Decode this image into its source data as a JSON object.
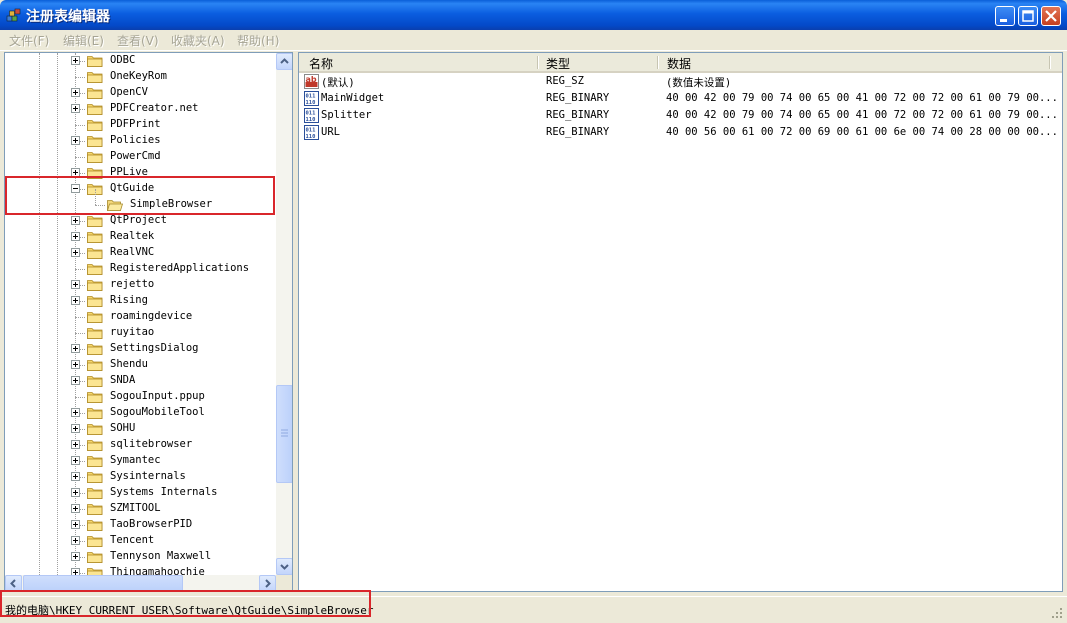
{
  "window": {
    "title": "注册表编辑器"
  },
  "menu": [
    {
      "label": "文件(F)"
    },
    {
      "label": "编辑(E)"
    },
    {
      "label": "查看(V)"
    },
    {
      "label": "收藏夹(A)"
    },
    {
      "label": "帮助(H)"
    }
  ],
  "tree": {
    "items": [
      {
        "label": "ODBC",
        "expander": "plus"
      },
      {
        "label": "OneKeyRom",
        "expander": "none"
      },
      {
        "label": "OpenCV",
        "expander": "plus"
      },
      {
        "label": "PDFCreator.net",
        "expander": "plus"
      },
      {
        "label": "PDFPrint",
        "expander": "none"
      },
      {
        "label": "Policies",
        "expander": "plus"
      },
      {
        "label": "PowerCmd",
        "expander": "none"
      },
      {
        "label": "PPLive",
        "expander": "plus"
      },
      {
        "label": "QtGuide",
        "expander": "minus"
      },
      {
        "label": "SimpleBrowser",
        "expander": "none",
        "child": true,
        "selected": true
      },
      {
        "label": "QtProject",
        "expander": "plus"
      },
      {
        "label": "Realtek",
        "expander": "plus"
      },
      {
        "label": "RealVNC",
        "expander": "plus"
      },
      {
        "label": "RegisteredApplications",
        "expander": "none"
      },
      {
        "label": "rejetto",
        "expander": "plus"
      },
      {
        "label": "Rising",
        "expander": "plus"
      },
      {
        "label": "roamingdevice",
        "expander": "none"
      },
      {
        "label": "ruyitao",
        "expander": "none"
      },
      {
        "label": "SettingsDialog",
        "expander": "plus"
      },
      {
        "label": "Shendu",
        "expander": "plus"
      },
      {
        "label": "SNDA",
        "expander": "plus"
      },
      {
        "label": "SogouInput.ppup",
        "expander": "none"
      },
      {
        "label": "SogouMobileTool",
        "expander": "plus"
      },
      {
        "label": "SOHU",
        "expander": "plus"
      },
      {
        "label": "sqlitebrowser",
        "expander": "plus"
      },
      {
        "label": "Symantec",
        "expander": "plus"
      },
      {
        "label": "Sysinternals",
        "expander": "plus"
      },
      {
        "label": "Systems Internals",
        "expander": "plus"
      },
      {
        "label": "SZMITOOL",
        "expander": "plus"
      },
      {
        "label": "TaoBrowserPID",
        "expander": "plus"
      },
      {
        "label": "Tencent",
        "expander": "plus"
      },
      {
        "label": "Tennyson Maxwell",
        "expander": "plus"
      },
      {
        "label": "Thingamahoochie",
        "expander": "plus"
      }
    ]
  },
  "list": {
    "columns": [
      {
        "label": "名称"
      },
      {
        "label": "类型"
      },
      {
        "label": "数据"
      }
    ],
    "rows": [
      {
        "icon": "string-value-icon",
        "name": "(默认)",
        "type": "REG_SZ",
        "data": "(数值未设置)"
      },
      {
        "icon": "binary-value-icon",
        "name": "MainWidget",
        "type": "REG_BINARY",
        "data": "40 00 42 00 79 00 74 00 65 00 41 00 72 00 72 00 61 00 79 00..."
      },
      {
        "icon": "binary-value-icon",
        "name": "Splitter",
        "type": "REG_BINARY",
        "data": "40 00 42 00 79 00 74 00 65 00 41 00 72 00 72 00 61 00 79 00..."
      },
      {
        "icon": "binary-value-icon",
        "name": "URL",
        "type": "REG_BINARY",
        "data": "40 00 56 00 61 00 72 00 69 00 61 00 6e 00 74 00 28 00 00 00..."
      }
    ]
  },
  "status": {
    "path": "我的电脑\\HKEY_CURRENT_USER\\Software\\QtGuide\\SimpleBrowser"
  },
  "colors": {
    "highlight": "#d9262b",
    "titlebar": "#0b5ee0"
  }
}
